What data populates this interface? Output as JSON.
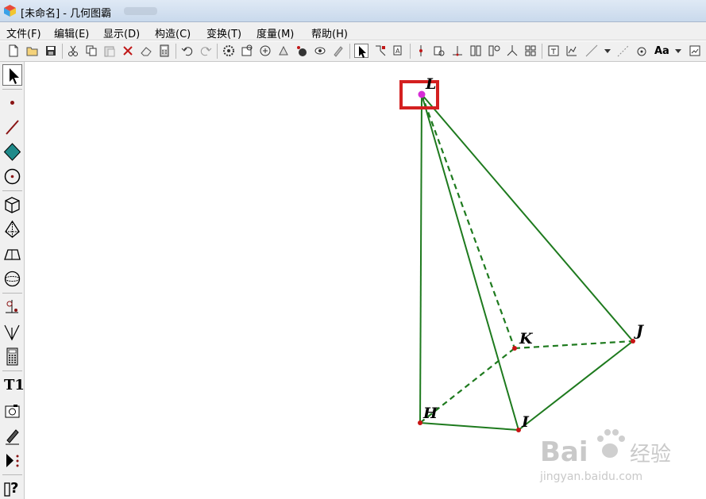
{
  "window": {
    "title": "[未命名] - 几何图霸"
  },
  "menu": [
    {
      "label": "文件(F)"
    },
    {
      "label": "编辑(E)"
    },
    {
      "label": "显示(D)"
    },
    {
      "label": "构造(C)"
    },
    {
      "label": "变换(T)"
    },
    {
      "label": "度量(M)"
    },
    {
      "label": "帮助(H)"
    }
  ],
  "toolbar": {
    "icons": [
      "new-file-icon",
      "open-file-icon",
      "save-icon",
      "cut-icon",
      "copy-icon",
      "paste-icon",
      "delete-icon",
      "eraser-icon",
      "calculator-icon",
      "undo-icon",
      "redo-icon",
      "settings-icon",
      "properties-icon",
      "animate-icon",
      "trace-icon",
      "point-on-object-icon",
      "hide-icon",
      "select-arrow-icon",
      "rotate-select-icon",
      "label-icon",
      "midpoint-icon",
      "intersection-icon",
      "perpendicular-icon",
      "parallel-icon",
      "bisector-icon",
      "coordinate-icon",
      "text-icon",
      "graph-icon",
      "line-style-icon",
      "color-icon",
      "text-style-icon",
      "fit-icon"
    ],
    "text_style_label": "Aa"
  },
  "toolbox": {
    "tools": [
      "select-arrow-icon",
      "point-tool-icon",
      "segment-tool-icon",
      "polygon-tool-icon",
      "circle-tool-icon",
      "cube-tool-icon",
      "pyramid-tool-icon",
      "prism-tool-icon",
      "sphere-tool-icon",
      "transform-tool-icon",
      "function-tool-icon",
      "calculator-tool-icon",
      "text-tool-icon",
      "camera-tool-icon",
      "pen-tool-icon",
      "animation-tool-icon",
      "help-tool-icon"
    ],
    "text_tool_label": "T1",
    "help_tool_label": "?"
  },
  "figure": {
    "labels": [
      "L",
      "K",
      "J",
      "H",
      "I"
    ],
    "line_color": "#1e7a1e",
    "point_color": "#c81414",
    "apex_color": "#d62cd6",
    "highlight_color": "#d42020"
  },
  "watermark": {
    "brand": "Bai",
    "brand_cn": "经验",
    "url": "jingyan.baidu.com"
  }
}
